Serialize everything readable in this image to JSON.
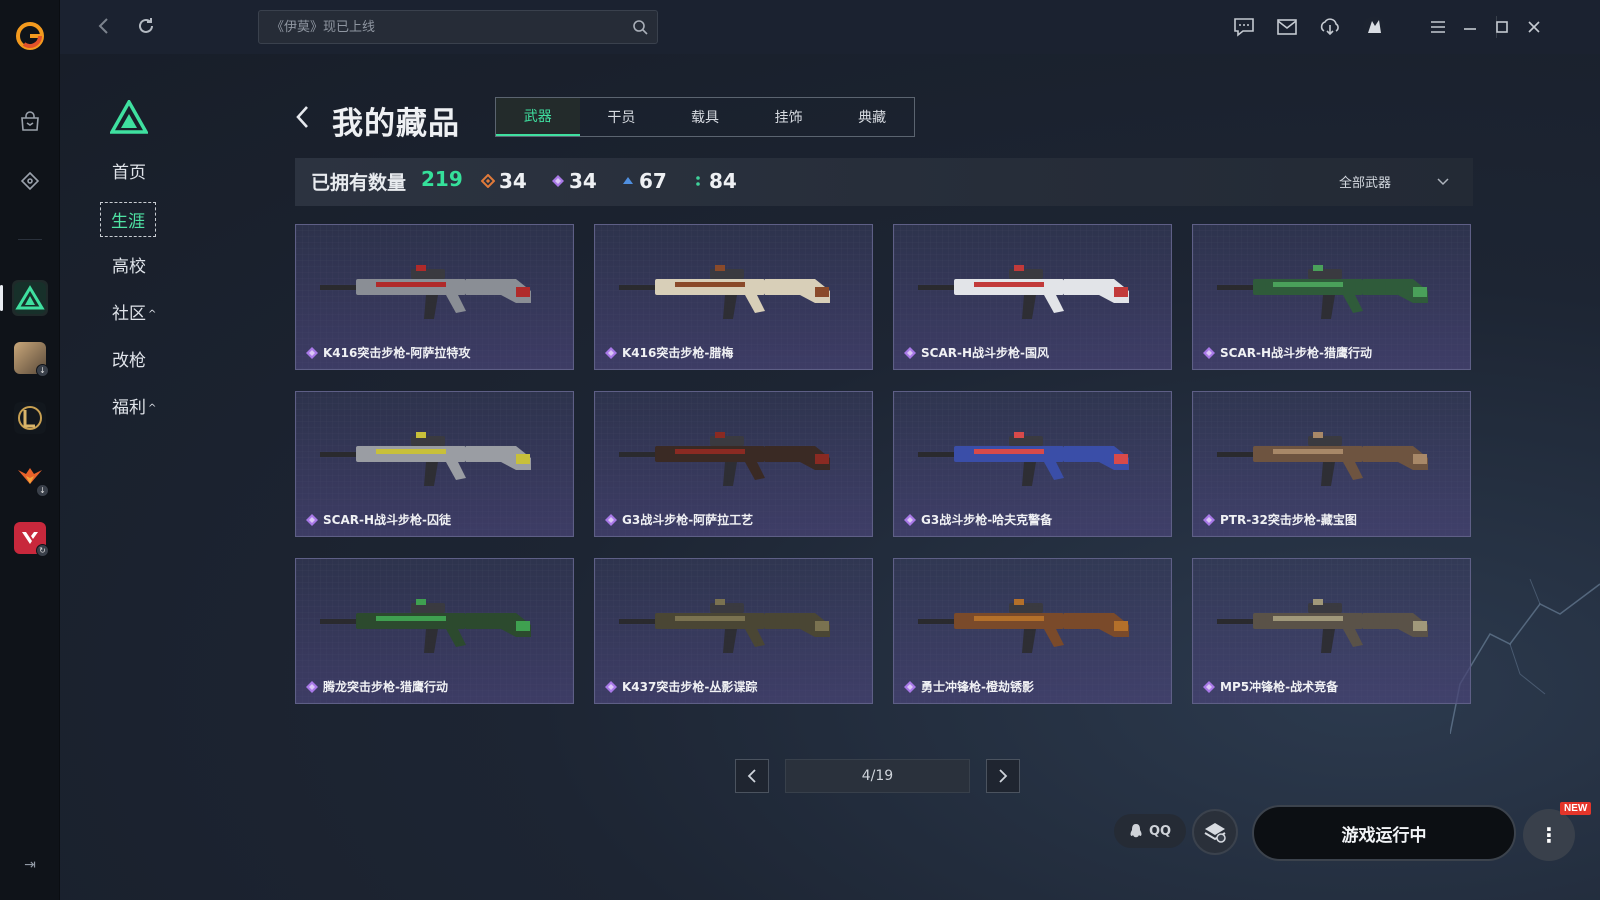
{
  "search": {
    "placeholder": "《伊莫》现已上线"
  },
  "sub_nav": {
    "items": [
      {
        "label": "首页",
        "active": false,
        "expandable": false
      },
      {
        "label": "生涯",
        "active": true,
        "expandable": false
      },
      {
        "label": "高校",
        "active": false,
        "expandable": false
      },
      {
        "label": "社区",
        "active": false,
        "expandable": true
      },
      {
        "label": "改枪",
        "active": false,
        "expandable": false
      },
      {
        "label": "福利",
        "active": false,
        "expandable": true
      }
    ],
    "caret": "^"
  },
  "page": {
    "title": "我的藏品"
  },
  "tabs": [
    {
      "label": "武器",
      "active": true
    },
    {
      "label": "干员",
      "active": false
    },
    {
      "label": "载具",
      "active": false
    },
    {
      "label": "挂饰",
      "active": false
    },
    {
      "label": "典藏",
      "active": false
    }
  ],
  "summary": {
    "label": "已拥有数量",
    "total": "219",
    "rarities": [
      {
        "count": "34",
        "color": "#e07a3a"
      },
      {
        "count": "34",
        "color": "#a979e8"
      },
      {
        "count": "67",
        "color": "#4f8fe0"
      },
      {
        "count": "84",
        "color": "#3fd19a"
      }
    ],
    "filter": "全部武器"
  },
  "items": [
    {
      "name": "K416突击步枪-阿萨拉特攻",
      "body": "#8a8e95",
      "accent": "#b02a2a"
    },
    {
      "name": "K416突击步枪-腊梅",
      "body": "#d8cfb8",
      "accent": "#8a4a2a"
    },
    {
      "name": "SCAR-H战斗步枪-国风",
      "body": "#e2e4e8",
      "accent": "#c23a3a"
    },
    {
      "name": "SCAR-H战斗步枪-猎鹰行动",
      "body": "#2f5b3a",
      "accent": "#4aa05a"
    },
    {
      "name": "SCAR-H战斗步枪-囚徒",
      "body": "#9a9da3",
      "accent": "#c8c03a"
    },
    {
      "name": "G3战斗步枪-阿萨拉工艺",
      "body": "#3a2a24",
      "accent": "#8a2a22"
    },
    {
      "name": "G3战斗步枪-哈夫克警备",
      "body": "#3a4ea8",
      "accent": "#d84a4a"
    },
    {
      "name": "PTR-32突击步枪-藏宝图",
      "body": "#6e5440",
      "accent": "#a88868"
    },
    {
      "name": "腾龙突击步枪-猎鹰行动",
      "body": "#2c4a2e",
      "accent": "#3fa050"
    },
    {
      "name": "K437突击步枪-丛影谍踪",
      "body": "#4a4634",
      "accent": "#7a7250"
    },
    {
      "name": "勇士冲锋枪-橙劫锈影",
      "body": "#7a4a2a",
      "accent": "#b4702a"
    },
    {
      "name": "MP5冲锋枪-战术竞备",
      "body": "#5a5248",
      "accent": "#a0987a"
    }
  ],
  "pager": {
    "label": "4/19",
    "current": 4,
    "total": 19
  },
  "bottom": {
    "qq_label": "QQ",
    "launch_label": "游戏运行中",
    "more_label": "⋮",
    "new_badge": "NEW"
  },
  "colors": {
    "accent": "#3fe0a0",
    "card_border": "#5e5f86",
    "rarity_purple": "#a979e8"
  }
}
